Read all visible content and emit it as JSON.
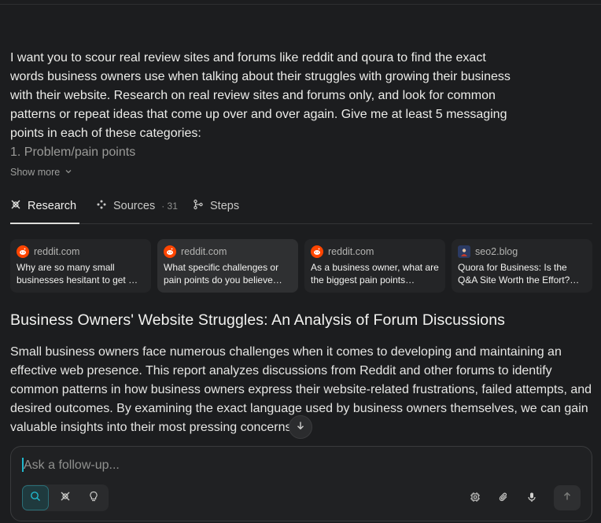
{
  "query": {
    "lines": [
      "I want you to scour real review sites and forums like reddit and qoura to find the exact",
      "words business owners use when talking about their struggles with growing their business",
      "with their website. Research on real review sites and forums only, and look for common",
      "patterns or repeat ideas that come up over and over again. Give me at least 5 messaging",
      "points in each of these categories:",
      "1. Problem/pain points"
    ],
    "show_more": "Show more"
  },
  "tabs": {
    "research": "Research",
    "sources": "Sources",
    "sources_count": "· 31",
    "steps": "Steps"
  },
  "sources": [
    {
      "site": "reddit.com",
      "title": "Why are so many small businesses hesitant to get …",
      "icon": "reddit-icon"
    },
    {
      "site": "reddit.com",
      "title": "What specific challenges or pain points do you believe…",
      "icon": "reddit-icon"
    },
    {
      "site": "reddit.com",
      "title": "As a business owner, what are the biggest pain points…",
      "icon": "reddit-icon"
    },
    {
      "site": "seo2.blog",
      "title": "Quora for Business: Is the Q&A Site Worth the Effort?…",
      "icon": "seo2-favicon"
    }
  ],
  "answer": {
    "title": "Business Owners' Website Struggles: An Analysis of Forum Discussions",
    "summary": "Small business owners face numerous challenges when it comes to developing and maintaining an effective web presence. This report analyzes discussions from Reddit and other forums to identify common patterns in how business owners express their website-related frustrations, failed attempts, and desired outcomes. By examining the exact language used by business owners themselves, we can gain valuable insights into their most pressing concerns."
  },
  "composer": {
    "placeholder": "Ask a follow-up..."
  },
  "colors": {
    "background": "#1c1d1f",
    "accent": "#20b8cd",
    "reddit": "#ff4500"
  }
}
